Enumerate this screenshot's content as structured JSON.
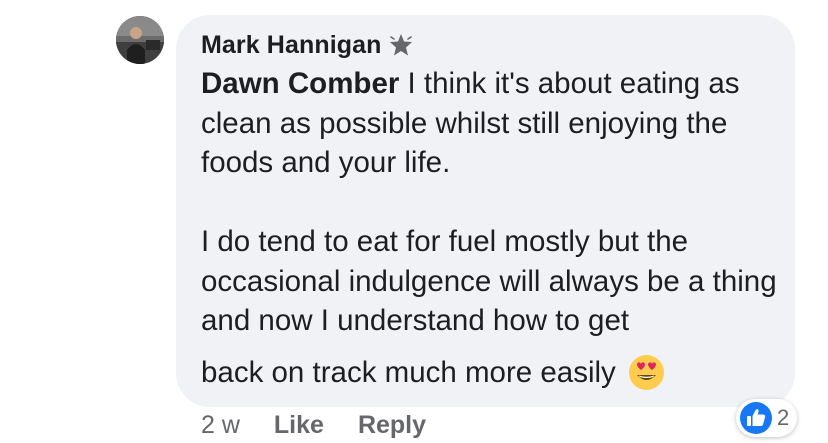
{
  "comment": {
    "author": "Mark Hannigan",
    "author_badge_icon": "star-badge-icon",
    "mention": "Dawn Comber",
    "text_after_mention": " I think it's about eating as clean as possible whilst still enjoying the foods and your life.",
    "paragraph2": "I do tend to eat for fuel mostly but the occasional indulgence will always be a thing and now I understand how to get",
    "last_line": "back on track much more easily",
    "emoji_icon": "heart-eyes-emoji-icon"
  },
  "actions": {
    "timestamp": "2 w",
    "like_label": "Like",
    "reply_label": "Reply"
  },
  "reactions": {
    "icon": "thumbs-up-icon",
    "count": "2"
  },
  "colors": {
    "bubble_bg": "#f0f2f5",
    "text": "#1c1e21",
    "secondary_text": "#65676b",
    "like_blue": "#1877f2"
  }
}
